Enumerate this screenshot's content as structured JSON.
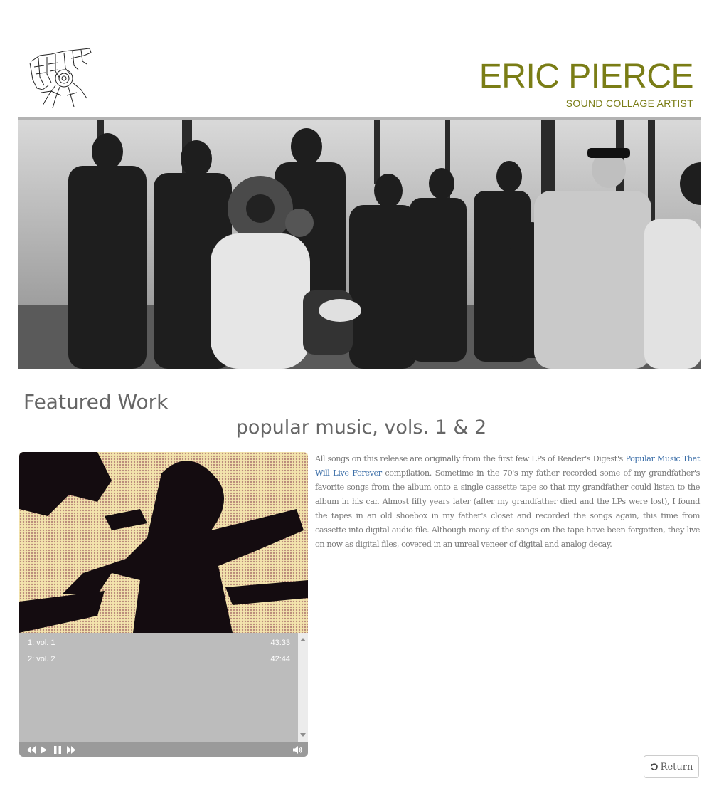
{
  "header": {
    "title": "ERIC PIERCE",
    "subtitle": "SOUND COLLAGE ARTIST",
    "accent_color": "#7a7d16",
    "logo": "sketch-drawing-logo"
  },
  "hero": {
    "image": "vintage-black-and-white-crowd-with-diving-suit-photo"
  },
  "featured": {
    "section_title": "Featured Work",
    "release_title": "popular music, vols. 1 & 2"
  },
  "player": {
    "cover_image": "halftone-album-cover",
    "tracks": [
      {
        "label": "1: vol. 1",
        "duration": "43:33"
      },
      {
        "label": "2: vol. 2",
        "duration": "42:44"
      }
    ],
    "controls": [
      "rewind-icon",
      "play-icon",
      "pause-icon",
      "fast-forward-icon",
      "volume-icon"
    ]
  },
  "description": {
    "part1": "All songs on this release are originally from the first few LPs of Reader's Digest's ",
    "link_text": "Popular Music That Will Live Forever",
    "part2": " compilation. Sometime in the 70's my father recorded some of my grandfather's favorite songs from the album onto a single cassette tape so that my grandfather could listen to the album in his car. Almost fifty years later (after my grandfather died and the LPs were lost), I found the tapes in an old shoebox in my father's closet and recorded the songs again, this time from cassette into digital audio file. Although many of the songs on the tape have been forgotten, they live on now as digital files, covered in an unreal veneer of digital and analog decay."
  },
  "return_button": {
    "label": "Return",
    "icon": "undo-icon"
  }
}
